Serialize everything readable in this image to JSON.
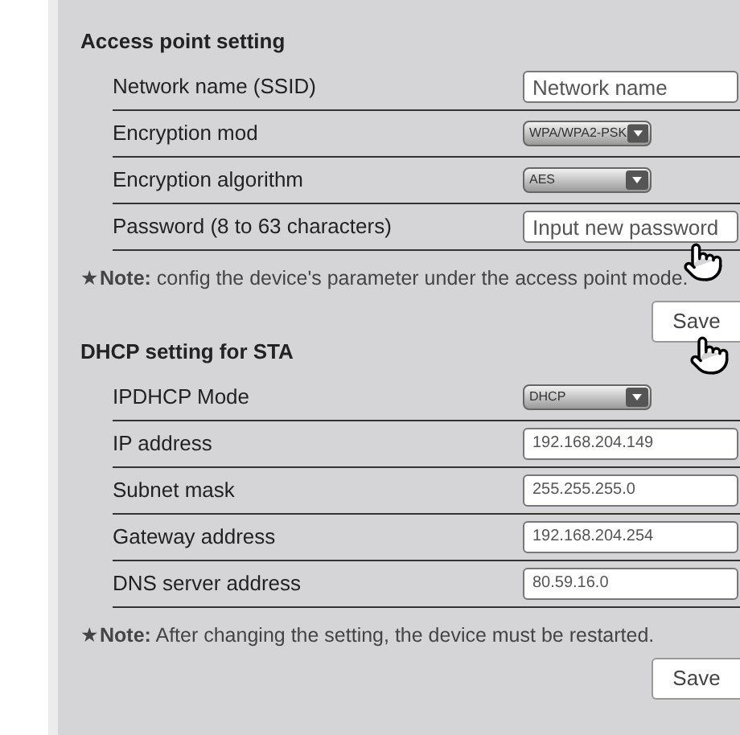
{
  "sections": [
    {
      "title": "Access point setting",
      "rows": [
        {
          "label": "Network name (SSID)",
          "kind": "input",
          "placeholder": "Network name"
        },
        {
          "label": "Encryption mod",
          "kind": "select",
          "value": "WPA/WPA2-PSK"
        },
        {
          "label": "Encryption algorithm",
          "kind": "select",
          "value": "AES"
        },
        {
          "label": "Password (8 to 63 characters)",
          "kind": "input",
          "placeholder": "Input new password"
        }
      ],
      "note": "★**Note:** config the device's parameter under the access point mode.",
      "save": "Save"
    },
    {
      "title": "DHCP setting for STA",
      "rows": [
        {
          "label": "IPDHCP Mode",
          "kind": "select",
          "value": "DHCP"
        },
        {
          "label": "IP address",
          "kind": "input",
          "value": "192.168.204.149"
        },
        {
          "label": "Subnet mask",
          "kind": "input",
          "value": "255.255.255.0"
        },
        {
          "label": "Gateway address",
          "kind": "input",
          "value": "192.168.204.254"
        },
        {
          "label": "DNS server address",
          "kind": "input",
          "value": "80.59.16.0"
        }
      ],
      "note": "★**Note:** After changing the setting, the device must be restarted.",
      "save": "Save"
    }
  ]
}
